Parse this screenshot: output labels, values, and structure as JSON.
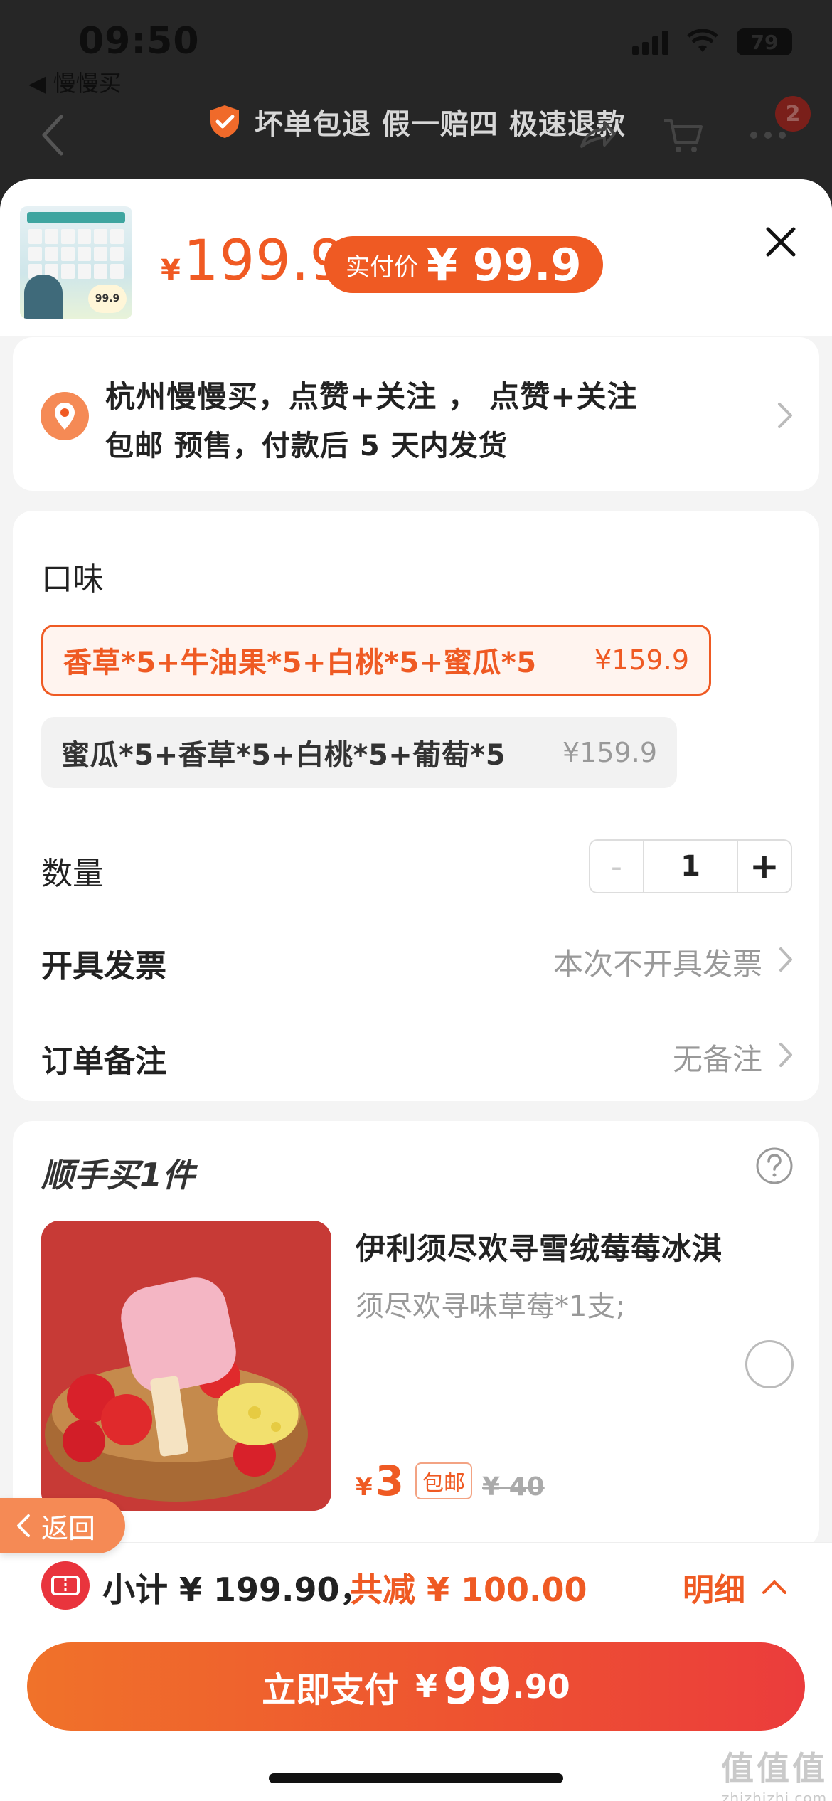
{
  "status": {
    "time": "09:50",
    "back_app": "◀ 慢慢买",
    "battery": "79"
  },
  "banner": {
    "text": "坏单包退 假一赔四 极速退款"
  },
  "nav": {
    "cart_badge": "2"
  },
  "product": {
    "price_yen": "¥",
    "price": "199.9",
    "paid_label": "实付价",
    "paid_value": "¥ 99.9",
    "thumb_price": "99.9"
  },
  "address": {
    "line1": "杭州慢慢买，点赞+关注 ， 点赞+关注",
    "line2": "包邮  预售，付款后 5 天内发货"
  },
  "options": {
    "title": "口味",
    "items": [
      {
        "name": "香草*5+牛油果*5+白桃*5+蜜瓜*5",
        "price": "¥159.9",
        "selected": true
      },
      {
        "name": "蜜瓜*5+香草*5+白桃*5+葡萄*5",
        "price": "¥159.9",
        "selected": false
      }
    ]
  },
  "quantity": {
    "label": "数量",
    "minus": "-",
    "value": "1",
    "plus": "+"
  },
  "invoice": {
    "label": "开具发票",
    "value": "本次不开具发票"
  },
  "remark": {
    "label": "订单备注",
    "value": "无备注"
  },
  "addon": {
    "title": "顺手买1件",
    "name": "伊利须尽欢寻雪绒莓莓冰淇",
    "desc": "须尽欢寻味草莓*1支;",
    "price_yen": "¥",
    "price": "3",
    "tag": "包邮",
    "old_price": "¥ 40"
  },
  "return_button": {
    "label": "返回"
  },
  "footer": {
    "subtotal": "小计 ¥ 199.90，",
    "discount": "共减 ¥ 100.00",
    "detail": "明细",
    "pay_label": "立即支付",
    "pay_yen": "¥",
    "pay_int": "99",
    "pay_dec": ".90"
  },
  "watermark": {
    "top": "值值值",
    "bottom": "zhizhizhi.com"
  },
  "colors": {
    "accent": "#ef5a23",
    "accent_light": "#fff4ef",
    "muted": "#999999"
  }
}
